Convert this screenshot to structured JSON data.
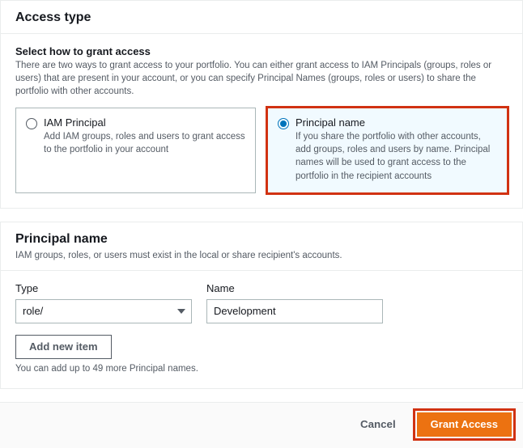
{
  "access_type": {
    "title": "Access type",
    "select_heading": "Select how to grant access",
    "select_desc": "There are two ways to grant access to your portfolio. You can either grant access to IAM Principals (groups, roles or users) that are present in your account, or you can specify Principal Names (groups, roles or users) to share the portfolio with other accounts.",
    "options": [
      {
        "label": "IAM Principal",
        "desc": "Add IAM groups, roles and users to grant access to the portfolio in your account"
      },
      {
        "label": "Principal name",
        "desc": "If you share the portfolio with other accounts, add groups, roles and users by name. Principal names will be used to grant access to the portfolio in the recipient accounts"
      }
    ]
  },
  "principal": {
    "title": "Principal name",
    "desc": "IAM groups, roles, or users must exist in the local or share recipient's accounts.",
    "type_label": "Type",
    "type_value": "role/",
    "name_label": "Name",
    "name_value": "Development",
    "add_label": "Add new item",
    "hint": "You can add up to 49 more Principal names."
  },
  "footer": {
    "cancel": "Cancel",
    "grant": "Grant Access"
  }
}
